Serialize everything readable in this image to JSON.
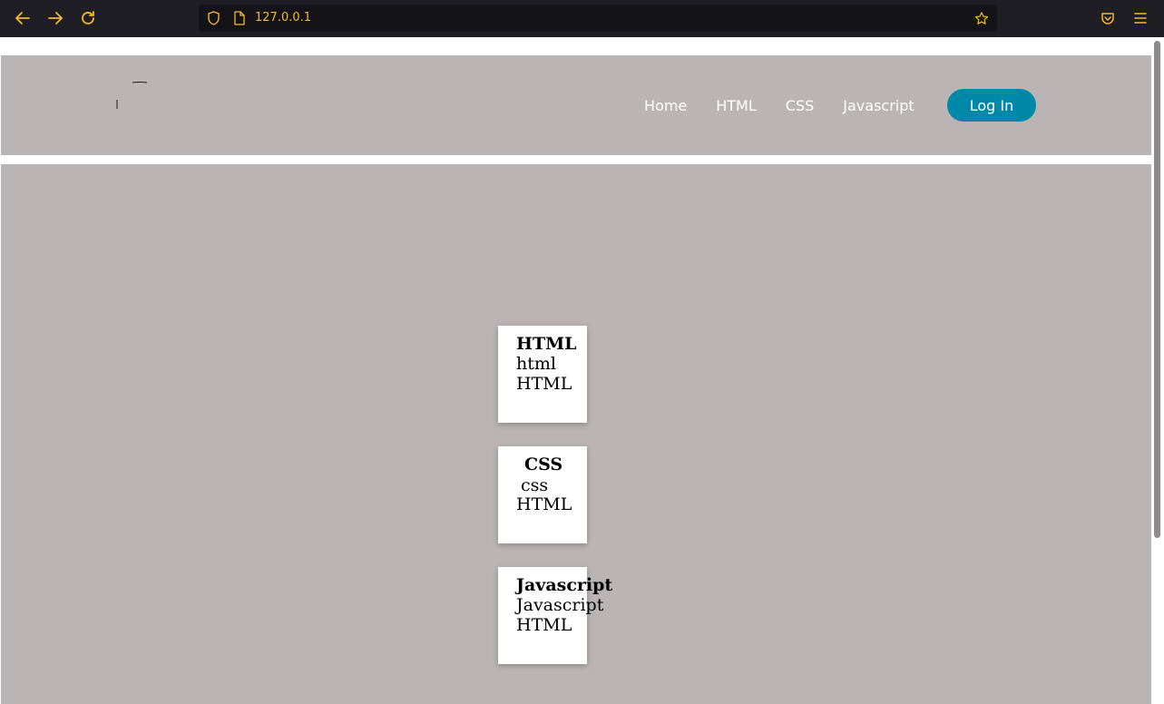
{
  "browser": {
    "url": "127.0.0.1",
    "accent_color": "#f5b82e",
    "icons": [
      "back-arrow-icon",
      "forward-arrow-icon",
      "reload-icon",
      "shield-icon",
      "page-icon",
      "star-icon",
      "pocket-icon",
      "hamburger-menu-icon"
    ]
  },
  "header": {
    "nav": [
      {
        "label": "Home"
      },
      {
        "label": "HTML"
      },
      {
        "label": "CSS"
      },
      {
        "label": "Javascript"
      }
    ],
    "login_label": "Log In",
    "background_color": "#bab5b4",
    "login_color": "#0088a9"
  },
  "cards": [
    {
      "title": "HTML",
      "line1": "html",
      "line2": "HTML"
    },
    {
      "title": "CSS",
      "line1": "css",
      "line2": "HTML"
    },
    {
      "title": "Javascript",
      "line1": "Javascript",
      "line2": "HTML"
    }
  ]
}
